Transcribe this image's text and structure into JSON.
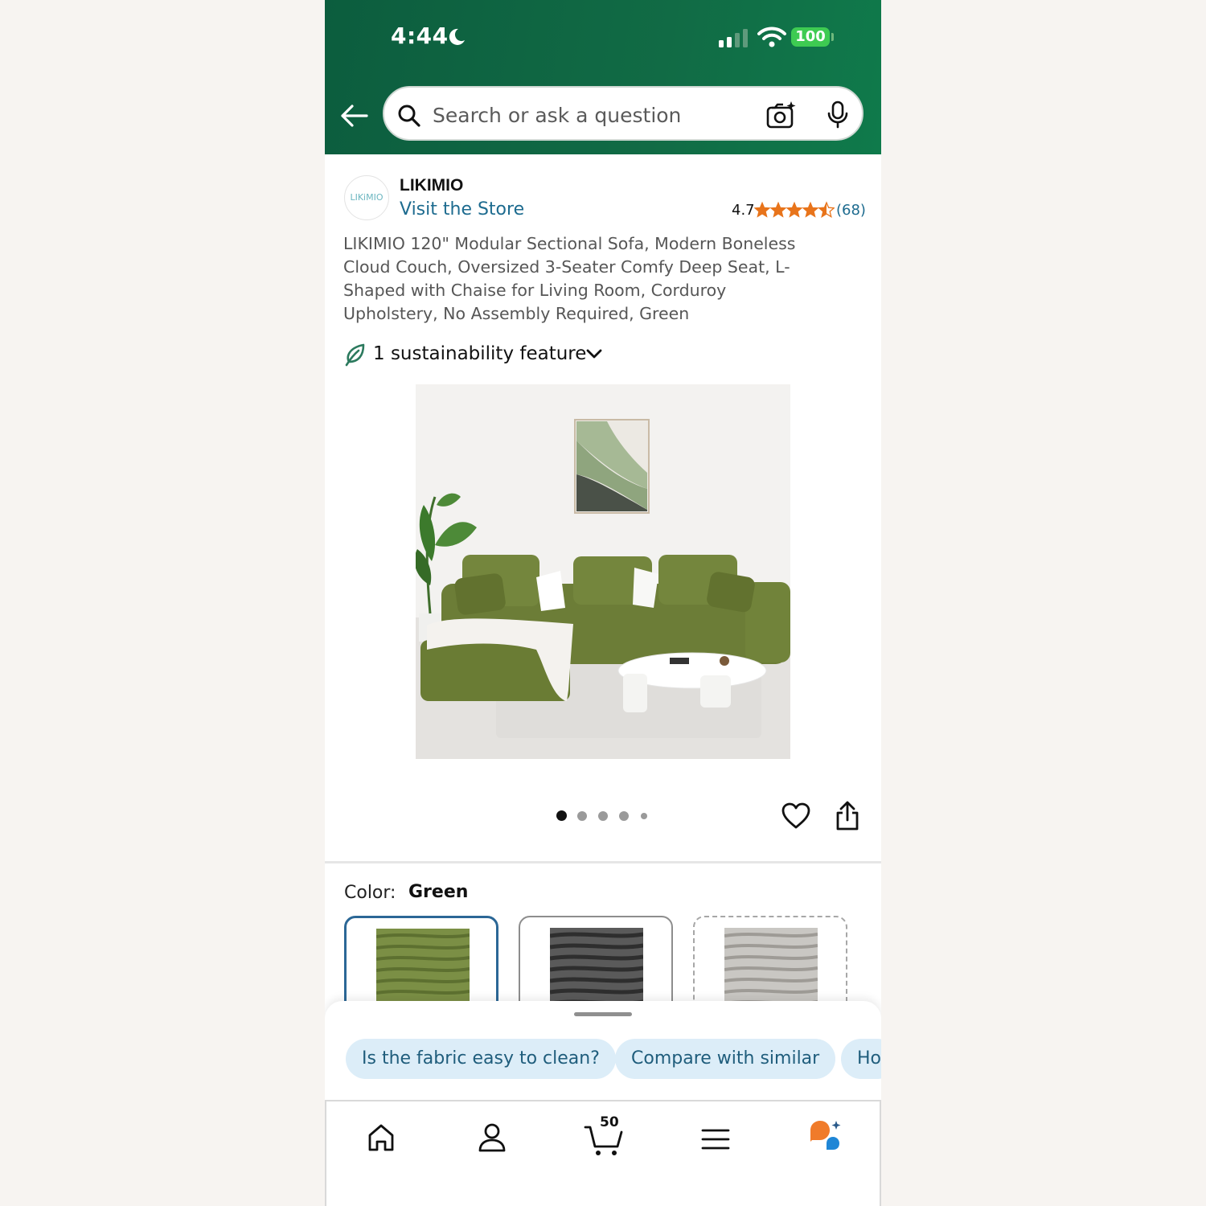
{
  "status_bar": {
    "time": "4:44",
    "battery": "100"
  },
  "search": {
    "placeholder": "Search or ask a question"
  },
  "brand": {
    "name": "LIKIMIO",
    "logo_text": "LIKiMIO",
    "store_link": "Visit the Store"
  },
  "rating": {
    "value": "4.7",
    "stars": 4.5,
    "count": "(68)"
  },
  "product": {
    "title": "LIKIMIO 120\" Modular Sectional Sofa, Modern Boneless Cloud Couch, Oversized 3-Seater Comfy Deep Seat, L-Shaped with Chaise for Living Room, Corduroy Upholstery, No Assembly Required, Green",
    "sustainability": "1 sustainability feature",
    "image_count": 5,
    "active_image": 1
  },
  "color": {
    "label": "Color:",
    "value": "Green",
    "options": [
      "Green",
      "Gray",
      "Light Gray"
    ]
  },
  "suggestions": [
    "Is the fabric easy to clean?",
    "Compare with similar",
    "Ho"
  ],
  "bottom_nav": {
    "cart_count": "50",
    "items": [
      "home-icon",
      "account-icon",
      "cart-icon",
      "menu-icon",
      "rufus-icon"
    ]
  },
  "colors": {
    "header": "#0f6a44",
    "link": "#1d6b8f",
    "star": "#e8741b",
    "chip_bg": "#dcedf8",
    "selected_border": "#2b6796"
  }
}
